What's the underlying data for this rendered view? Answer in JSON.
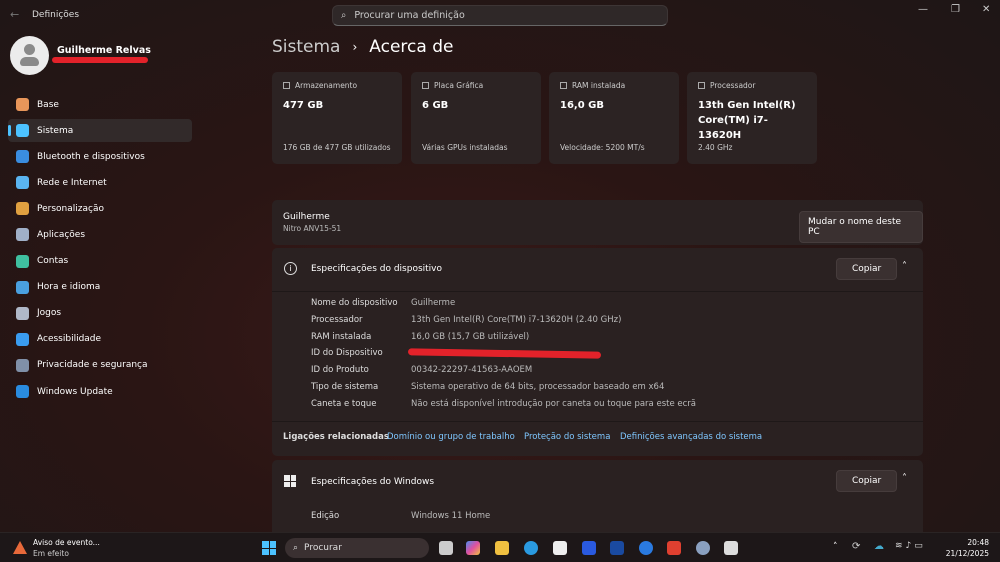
{
  "window": {
    "title": "Definições",
    "search_placeholder": "Procurar uma definição"
  },
  "user": {
    "name": "Guilherme Relvas"
  },
  "sidebar": {
    "items": [
      {
        "label": "Base",
        "icon": "home-icon",
        "color": "#e8965a"
      },
      {
        "label": "Sistema",
        "icon": "system-icon",
        "color": "#4cc2ff",
        "active": true
      },
      {
        "label": "Bluetooth e dispositivos",
        "icon": "bluetooth-icon",
        "color": "#3a8de0"
      },
      {
        "label": "Rede e Internet",
        "icon": "wifi-icon",
        "color": "#5ab4f0"
      },
      {
        "label": "Personalização",
        "icon": "brush-icon",
        "color": "#e0a040"
      },
      {
        "label": "Aplicações",
        "icon": "apps-icon",
        "color": "#a0b0c8"
      },
      {
        "label": "Contas",
        "icon": "person-icon",
        "color": "#3fc0a0"
      },
      {
        "label": "Hora e idioma",
        "icon": "globe-clock-icon",
        "color": "#4aa0e0"
      },
      {
        "label": "Jogos",
        "icon": "gamepad-icon",
        "color": "#b0b8c8"
      },
      {
        "label": "Acessibilidade",
        "icon": "accessibility-icon",
        "color": "#3a9cf0"
      },
      {
        "label": "Privacidade e segurança",
        "icon": "shield-icon",
        "color": "#8090a8"
      },
      {
        "label": "Windows Update",
        "icon": "update-icon",
        "color": "#2a8ce0"
      }
    ]
  },
  "breadcrumb": {
    "parent": "Sistema",
    "current": "Acerca de"
  },
  "cards": [
    {
      "label": "Armazenamento",
      "value": "477 GB",
      "sub": "176 GB de 477 GB utilizados",
      "icon": "storage-icon"
    },
    {
      "label": "Placa Gráfica",
      "value": "6 GB",
      "sub": "Várias GPUs instaladas",
      "icon": "gpu-icon"
    },
    {
      "label": "RAM instalada",
      "value": "16,0 GB",
      "sub": "Velocidade: 5200 MT/s",
      "icon": "ram-icon"
    },
    {
      "label": "Processador",
      "value": "13th Gen Intel(R) Core(TM) i7-13620H",
      "sub": "2.40 GHz",
      "icon": "cpu-icon"
    }
  ],
  "device": {
    "name": "Guilherme",
    "model": "Nitro ANV15-51",
    "rename_label": "Mudar o nome deste PC"
  },
  "device_specs": {
    "title": "Especificações do dispositivo",
    "copy_label": "Copiar",
    "rows": [
      {
        "label": "Nome do dispositivo",
        "value": "Guilherme"
      },
      {
        "label": "Processador",
        "value": "13th Gen Intel(R) Core(TM) i7-13620H (2.40 GHz)"
      },
      {
        "label": "RAM instalada",
        "value": "16,0 GB (15,7 GB utilizável)"
      },
      {
        "label": "ID do Dispositivo",
        "value": ""
      },
      {
        "label": "ID do Produto",
        "value": "00342-22297-41563-AAOEM"
      },
      {
        "label": "Tipo de sistema",
        "value": "Sistema operativo de 64 bits, processador baseado em x64"
      },
      {
        "label": "Caneta e toque",
        "value": "Não está disponível introdução por caneta ou toque para este ecrã"
      }
    ]
  },
  "related": {
    "label": "Ligações relacionadas",
    "links": [
      "Domínio ou grupo de trabalho",
      "Proteção do sistema",
      "Definições avançadas do sistema"
    ]
  },
  "windows_specs": {
    "title": "Especificações do Windows",
    "copy_label": "Copiar",
    "rows": [
      {
        "label": "Edição",
        "value": "Windows 11 Home"
      }
    ]
  },
  "taskbar": {
    "notification_title": "Aviso de evento...",
    "notification_sub": "Em efeito",
    "search_label": "Procurar",
    "time": "20:48",
    "date": "21/12/2025"
  }
}
